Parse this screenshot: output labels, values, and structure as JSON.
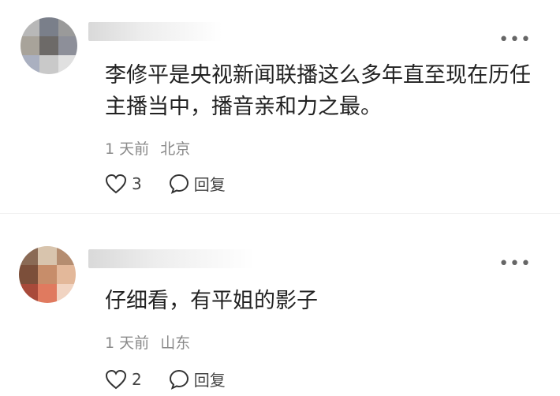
{
  "comments": [
    {
      "text": "李修平是央视新闻联播这么多年直至现在历任主播当中，播音亲和力之最。",
      "time": "1 天前",
      "location": "北京",
      "likes": "3",
      "reply_label": "回复",
      "avatar_colors": [
        "#b8b8b8",
        "#7a7f8a",
        "#9a9a9a",
        "#a8a39a",
        "#6d6a68",
        "#8d8f99",
        "#aab0c0",
        "#c9c9c9",
        "#e0e0e0"
      ]
    },
    {
      "text": "仔细看，有平姐的影子",
      "time": "1 天前",
      "location": "山东",
      "likes": "2",
      "reply_label": "回复",
      "avatar_colors": [
        "#8a6a55",
        "#d8c4ad",
        "#b58d70",
        "#7c4f3a",
        "#c78d6a",
        "#e3b89a",
        "#a84a3a",
        "#e07a5f",
        "#f1d4c2"
      ]
    }
  ],
  "icons": {
    "more": "more-icon",
    "like": "heart-icon",
    "reply": "reply-icon"
  }
}
